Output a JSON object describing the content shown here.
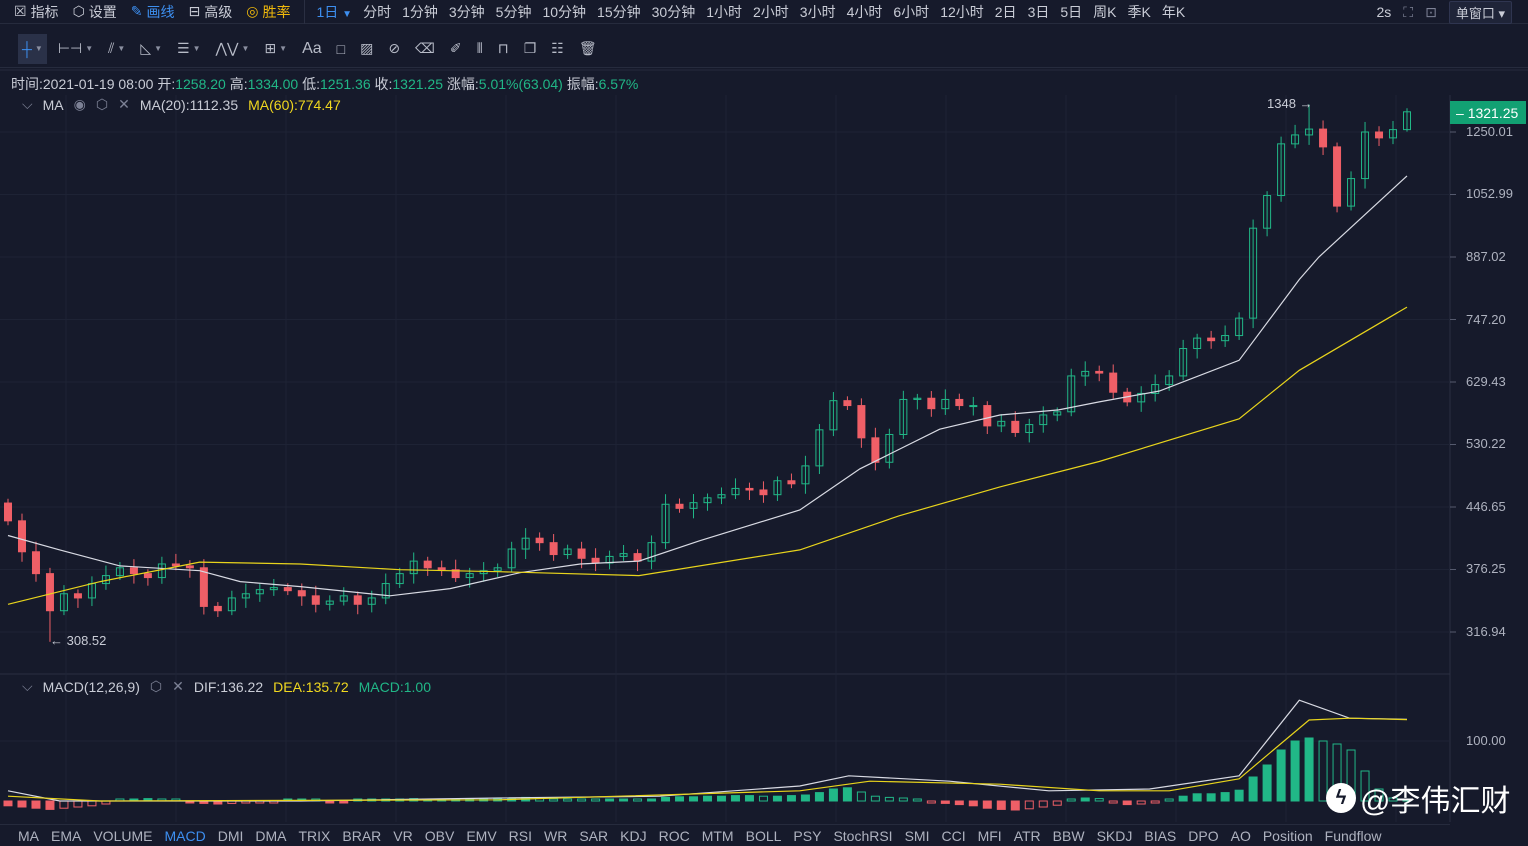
{
  "topbar": {
    "items": [
      {
        "label": "指标",
        "icon": "chart-icon"
      },
      {
        "label": "设置",
        "icon": "gear-icon"
      },
      {
        "label": "画线",
        "icon": "pen-icon"
      },
      {
        "label": "高级",
        "icon": "layout-icon"
      },
      {
        "label": "胜率",
        "icon": "gauge-icon"
      }
    ],
    "active_period": "1日",
    "periods": [
      "分时",
      "1分钟",
      "3分钟",
      "5分钟",
      "10分钟",
      "15分钟",
      "30分钟",
      "1小时",
      "2小时",
      "3小时",
      "4小时",
      "6小时",
      "12小时",
      "2日",
      "3日",
      "5日",
      "周K",
      "季K",
      "年K"
    ],
    "refresh": "2s",
    "window_mode": "单窗口"
  },
  "toolbar": [
    "crosshair-icon",
    "horizontal-line-icon",
    "trend-line-icon",
    "angle-icon",
    "parallel-lines-icon",
    "wave-icon",
    "measure-box-icon",
    "text-icon",
    "ruler-icon",
    "magnet-icon",
    "eraser-icon",
    "brush-icon",
    "bars-pattern-icon",
    "lock-icon",
    "copy-icon",
    "settings-template-icon",
    "trash-icon"
  ],
  "toolbar_text": "Aa",
  "info": {
    "time_label": "时间:",
    "time": "2021-01-19 08:00",
    "open_label": "开:",
    "open": "1258.20",
    "high_label": "高:",
    "high": "1334.00",
    "low_label": "低:",
    "low": "1251.36",
    "close_label": "收:",
    "close": "1321.25",
    "change_label": "涨幅:",
    "change": "5.01%(63.04)",
    "amp_label": "振幅:",
    "amp": "6.57%"
  },
  "ma_legend": {
    "name": "MA",
    "ma20": "MA(20):1112.35",
    "ma60": "MA(60):774.47"
  },
  "macd_legend": {
    "name": "MACD(12,26,9)",
    "dif": "DIF:136.22",
    "dea": "DEA:135.72",
    "macd": "MACD:1.00"
  },
  "price_axis": [
    "1250.01",
    "1052.99",
    "887.02",
    "747.20",
    "629.43",
    "530.22",
    "446.65",
    "376.25",
    "316.94"
  ],
  "macd_axis": [
    "100.00"
  ],
  "current_price": "1321.25",
  "high_marker": "1348 →",
  "low_marker": "← 308.52",
  "colors": {
    "up": "#21b787",
    "down": "#ef5f67",
    "ma20": "#d8dae3",
    "ma60": "#e8d41c",
    "accent": "#3d8ff0",
    "background": "#161a2b"
  },
  "chart_data": {
    "type": "candlestick",
    "yscale": "log",
    "ylim": [
      300,
      1400
    ],
    "last_candle": {
      "open": 1258.2,
      "high": 1334.0,
      "low": 1251.36,
      "close": 1321.25
    },
    "closes": [
      430,
      395,
      372,
      336,
      352,
      348,
      362,
      370,
      378,
      372,
      368,
      382,
      380,
      378,
      340,
      336,
      348,
      352,
      356,
      358,
      355,
      350,
      342,
      345,
      350,
      342,
      348,
      362,
      372,
      385,
      378,
      376,
      368,
      372,
      375,
      378,
      398,
      410,
      405,
      392,
      398,
      388,
      383,
      390,
      393,
      385,
      405,
      450,
      445,
      452,
      458,
      462,
      470,
      468,
      462,
      480,
      476,
      500,
      552,
      598,
      590,
      540,
      505,
      545,
      600,
      602,
      585,
      600,
      590,
      590,
      558,
      565,
      548,
      560,
      575,
      580,
      640,
      648,
      645,
      612,
      596,
      610,
      625,
      640,
      690,
      710,
      705,
      715,
      750,
      960,
      1050,
      1210,
      1240,
      1260,
      1200,
      1020,
      1100,
      1250,
      1230,
      1258.2,
      1321.25
    ],
    "ma20": [
      [
        0,
        413
      ],
      [
        3.7,
        397
      ],
      [
        8,
        380
      ],
      [
        13.7,
        375
      ],
      [
        16.6,
        364
      ],
      [
        20.9,
        359
      ],
      [
        27.3,
        350
      ],
      [
        31.6,
        357
      ],
      [
        36.6,
        373
      ],
      [
        40.9,
        382
      ],
      [
        45.1,
        385
      ],
      [
        49.4,
        407
      ],
      [
        56.6,
        443
      ],
      [
        60.9,
        496
      ],
      [
        66.6,
        553
      ],
      [
        70.9,
        575
      ],
      [
        75.1,
        583
      ],
      [
        78,
        596
      ],
      [
        82.3,
        614
      ],
      [
        88,
        668
      ],
      [
        92.3,
        834
      ],
      [
        93.7,
        887
      ],
      [
        100,
        1108
      ]
    ],
    "ma60": [
      [
        0,
        342
      ],
      [
        6.6,
        364
      ],
      [
        13.7,
        384
      ],
      [
        20.9,
        382
      ],
      [
        28,
        376
      ],
      [
        35.1,
        374
      ],
      [
        45.1,
        370
      ],
      [
        56.6,
        397
      ],
      [
        63.7,
        436
      ],
      [
        70.9,
        472
      ],
      [
        78,
        506
      ],
      [
        88,
        569
      ],
      [
        92.3,
        650
      ],
      [
        100,
        773
      ]
    ],
    "macd": {
      "hist": [
        -8,
        -10,
        -12,
        -14,
        -12,
        -10,
        -8,
        -5,
        2,
        3,
        4,
        3,
        2,
        -2,
        -4,
        -5,
        -4,
        -3,
        -2,
        -1,
        1,
        1,
        0,
        -1,
        -1,
        0,
        1,
        2,
        3,
        4,
        3,
        2,
        1,
        1,
        2,
        3,
        5,
        6,
        5,
        3,
        2,
        1,
        0,
        1,
        1,
        0,
        2,
        6,
        7,
        7,
        8,
        8,
        9,
        9,
        8,
        8,
        9,
        10,
        14,
        20,
        22,
        15,
        8,
        6,
        5,
        3,
        -2,
        -4,
        -6,
        -8,
        -12,
        -14,
        -15,
        -13,
        -10,
        -7,
        3,
        5,
        4,
        -2,
        -6,
        -5,
        -3,
        2,
        8,
        12,
        12,
        14,
        18,
        40,
        60,
        85,
        100,
        105,
        100,
        95,
        85,
        50,
        20,
        5,
        1
      ],
      "dif": [
        [
          0,
          17
        ],
        [
          3.7,
          0
        ],
        [
          20.9,
          0
        ],
        [
          35.1,
          5
        ],
        [
          46.6,
          8
        ],
        [
          56.6,
          25
        ],
        [
          60.1,
          42
        ],
        [
          67.3,
          33
        ],
        [
          74.4,
          17
        ],
        [
          81.6,
          20
        ],
        [
          88,
          42
        ],
        [
          92.3,
          168
        ],
        [
          95.9,
          138
        ],
        [
          100,
          136.22
        ]
      ],
      "dea": [
        [
          0,
          8
        ],
        [
          6.6,
          0
        ],
        [
          35.1,
          2
        ],
        [
          56.6,
          17
        ],
        [
          61.6,
          33
        ],
        [
          70.9,
          28
        ],
        [
          78,
          17
        ],
        [
          83,
          17
        ],
        [
          88,
          37
        ],
        [
          93,
          135
        ],
        [
          95.9,
          138
        ],
        [
          100,
          135.72
        ]
      ]
    }
  },
  "bottom_tabs": [
    "MA",
    "EMA",
    "VOLUME",
    "MACD",
    "DMI",
    "DMA",
    "TRIX",
    "BRAR",
    "VR",
    "OBV",
    "EMV",
    "RSI",
    "WR",
    "SAR",
    "KDJ",
    "ROC",
    "MTM",
    "BOLL",
    "PSY",
    "StochRSI",
    "SMI",
    "CCI",
    "MFI",
    "ATR",
    "BBW",
    "SKDJ",
    "BIAS",
    "DPO",
    "AO",
    "Position",
    "Fundflow"
  ],
  "active_tab": "MACD",
  "watermark": "@李伟汇财"
}
